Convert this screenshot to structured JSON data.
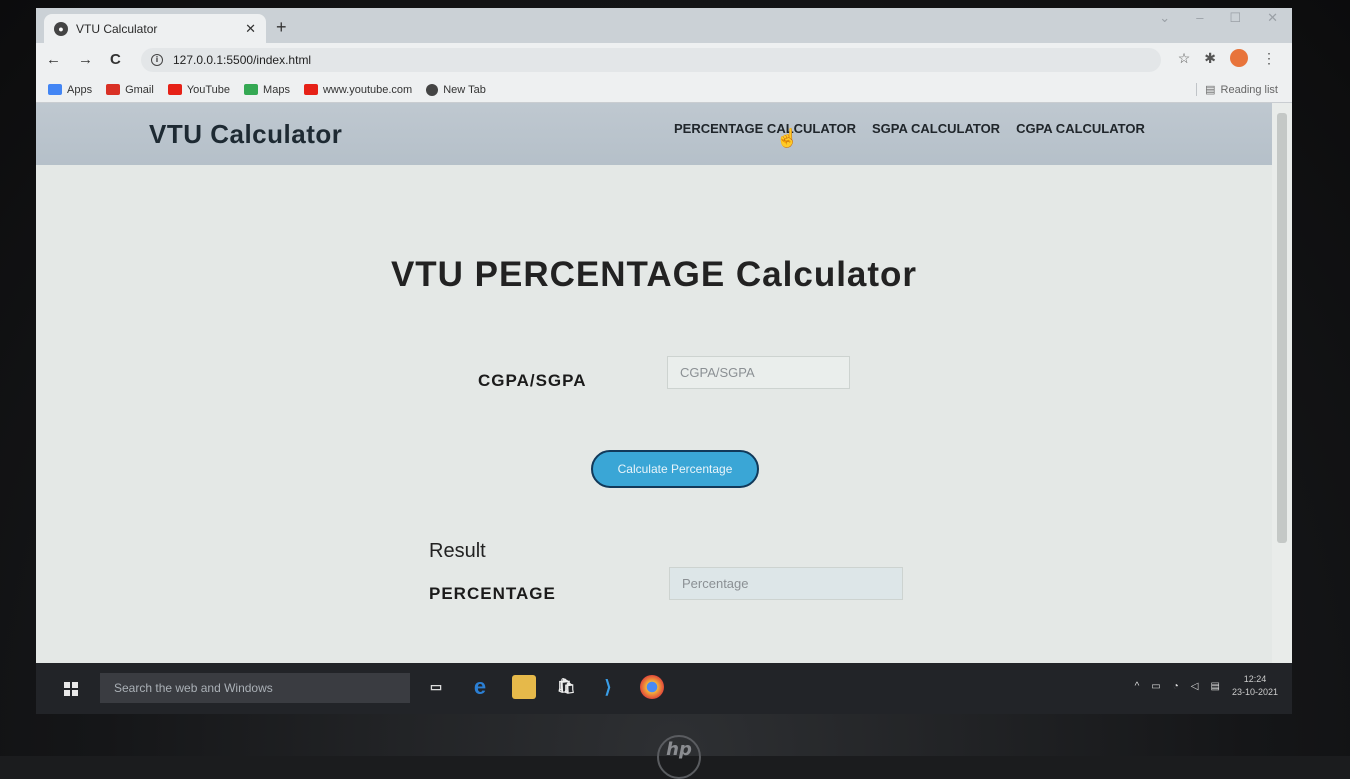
{
  "browser": {
    "tab_title": "VTU Calculator",
    "url": "127.0.0.1:5500/index.html",
    "bookmarks": [
      {
        "label": "Apps",
        "color": "#4285f4"
      },
      {
        "label": "Gmail",
        "color": "#d93025"
      },
      {
        "label": "YouTube",
        "color": "#e62117"
      },
      {
        "label": "Maps",
        "color": "#34a853"
      },
      {
        "label": "www.youtube.com",
        "color": "#e62117"
      },
      {
        "label": "New Tab",
        "color": "#444444"
      }
    ],
    "reading_list": "Reading list"
  },
  "site": {
    "brand": "VTU Calculator",
    "menu": [
      "PERCENTAGE CALCULATOR",
      "SGPA CALCULATOR",
      "CGPA CALCULATOR"
    ]
  },
  "main": {
    "title": "VTU PERCENTAGE Calculator",
    "input_label": "CGPA/SGPA",
    "input_placeholder": "CGPA/SGPA",
    "button_label": "Calculate Percentage",
    "result_heading": "Result",
    "result_label": "PERCENTAGE",
    "result_placeholder": "Percentage"
  },
  "taskbar": {
    "search_placeholder": "Search the web and Windows",
    "time": "12:24",
    "date": "23-10-2021"
  },
  "colors": {
    "accent_button": "#3aa6d6",
    "header_bg": "#b5c0c9"
  }
}
